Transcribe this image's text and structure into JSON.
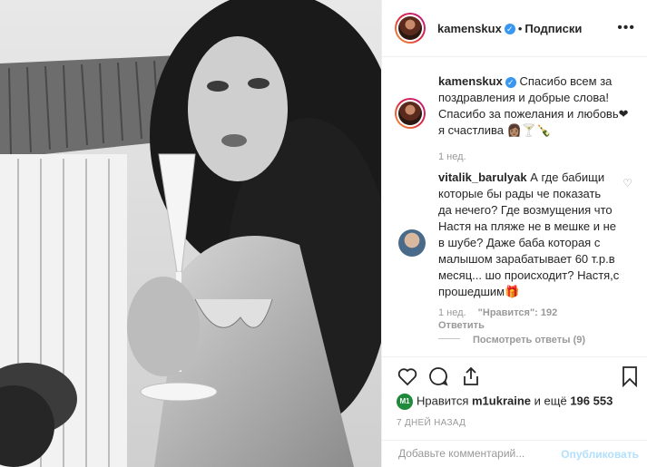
{
  "post": {
    "author": "kamenskux",
    "follow_label": "Подписки",
    "dot": "•",
    "more": "•••"
  },
  "caption": {
    "author": "kamenskux",
    "text_line1": "Спасибо всем за",
    "text_line2": "поздравления и добрые слова!",
    "text_line3": "Спасибо за пожелания и любовь❤",
    "text_line4": "я счастлива 👩🏽🍸🍾",
    "time": "1 нед."
  },
  "comment": {
    "author": "vitalik_barulyak",
    "lines": [
      "А где бабищи",
      "которые бы рады че показать",
      "да нечего? Где возмущения что",
      "Настя на пляже не в мешке и не",
      "в шубе? Даже баба которая с",
      "малышом зарабатывает 60 т.р.в",
      "месяц... шо происходит? Настя,с",
      "прошедшим🎁"
    ],
    "time": "1 нед.",
    "likes": "\"Нравится\": 192",
    "reply": "Ответить",
    "view_replies": "Посмотреть ответы (9)"
  },
  "actions": {
    "likes_prefix": "Нравится",
    "liker": "m1ukraine",
    "likes_mid": "и ещё",
    "likes_count": "196 553",
    "date": "7 ДНЕЙ НАЗАД",
    "mini_avatar_text": "M1"
  },
  "composer": {
    "placeholder": "Добавьте комментарий...",
    "publish": "Опубликовать"
  },
  "colors": {
    "link_blue": "#3897f0",
    "muted": "#999999",
    "publish_disabled": "#b2dffc"
  }
}
